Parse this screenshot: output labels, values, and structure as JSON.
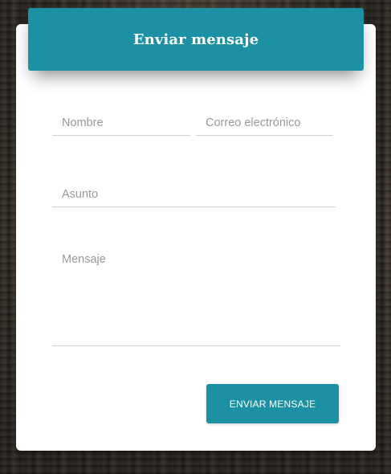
{
  "form": {
    "title": "Enviar mensaje",
    "fields": {
      "nombre_placeholder": "Nombre",
      "correo_placeholder": "Correo electrónico",
      "asunto_placeholder": "Asunto",
      "mensaje_placeholder": "Mensaje"
    },
    "submit_label": "ENVIAR MENSAJE"
  },
  "colors": {
    "accent": "#1b91a3",
    "card_background": "#ffffff",
    "field_border": "#d2d2d2",
    "placeholder_text": "#9a9a9a"
  }
}
